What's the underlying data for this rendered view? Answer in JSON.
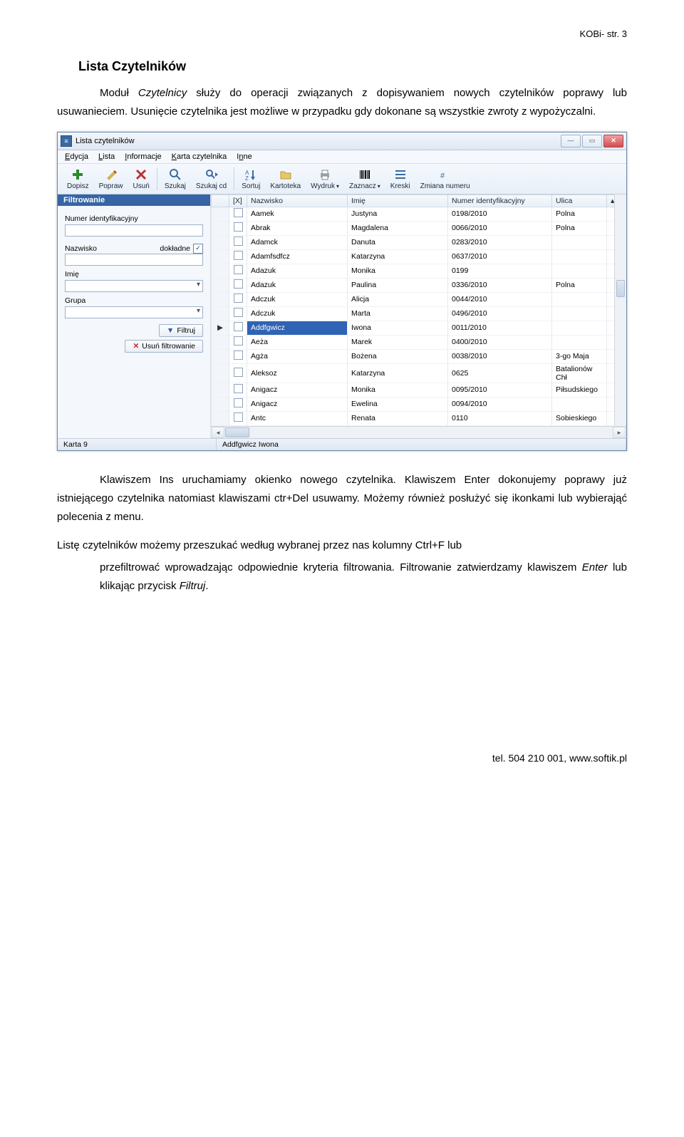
{
  "doc": {
    "header_right": "KOBi- str. 3",
    "title": "Lista Czytelników",
    "p1": "Moduł Czytelnicy służy do operacji związanych z dopisywaniem nowych czytelników poprawy lub usuwanieciem. Usunięcie czytelnika jest możliwe w przypadku gdy dokonane są wszystkie zwroty z wypożyczalni.",
    "p2": "Klawiszem Ins uruchamiamy okienko nowego czytelnika. Klawiszem Enter dokonujemy poprawy już istniejącego czytelnika natomiast klawiszami ctr+Del usuwamy. Możemy również posłużyć się ikonkami lub wybierająć polecenia z menu.",
    "p3a": "Listę czytelników możemy przeszukać według wybranej przez nas kolumny Ctrl+F lub",
    "p3b": "przefiltrować wprowadzając odpowiednie kryteria filtrowania. Filtrowanie zatwierdzamy klawiszem Enter lub klikając  przycisk Filtruj.",
    "footer": "tel. 504 210 001,  www.softik.pl"
  },
  "win": {
    "title": "Lista czytelników",
    "menus": [
      "Edycja",
      "Lista",
      "Informacje",
      "Karta czytelnika",
      "Inne"
    ],
    "toolbar": [
      "Dopisz",
      "Popraw",
      "Usuń",
      "Szukaj",
      "Szukaj cd",
      "Sortuj",
      "Kartoteka",
      "Wydruk",
      "Zaznacz",
      "Kreski",
      "Zmiana numeru"
    ],
    "sidebar": {
      "header": "Filtrowanie",
      "lbl_numer": "Numer identyfikacyjny",
      "lbl_nazwisko": "Nazwisko",
      "lbl_imie": "Imię",
      "lbl_grupa": "Grupa",
      "chk_dokladne": "dokładne",
      "btn_filtruj": "Filtruj",
      "btn_usun": "Usuń filtrowanie"
    },
    "columns": {
      "chk": "[X]",
      "nazwisko": "Nazwisko",
      "imie": "Imię",
      "numer": "Numer identyfikacyjny",
      "ulica": "Ulica"
    },
    "rows": [
      {
        "n": "Aamek",
        "i": "Justyna",
        "id": "0198/2010",
        "u": "Polna"
      },
      {
        "n": "Abrak",
        "i": "Magdalena",
        "id": "0066/2010",
        "u": "Polna"
      },
      {
        "n": "Adamck",
        "i": "Danuta",
        "id": "0283/2010",
        "u": ""
      },
      {
        "n": "Adamfsdfcz",
        "i": "Katarzyna",
        "id": "0637/2010",
        "u": ""
      },
      {
        "n": "Adazuk",
        "i": "Monika",
        "id": "0199",
        "u": ""
      },
      {
        "n": "Adazuk",
        "i": "Paulina",
        "id": "0336/2010",
        "u": "Polna"
      },
      {
        "n": "Adczuk",
        "i": "Alicja",
        "id": "0044/2010",
        "u": ""
      },
      {
        "n": "Adczuk",
        "i": "Marta",
        "id": "0496/2010",
        "u": ""
      },
      {
        "n": "Addfgwicz",
        "i": "Iwona",
        "id": "0011/2010",
        "u": "",
        "sel": true
      },
      {
        "n": "Aeża",
        "i": "Marek",
        "id": "0400/2010",
        "u": ""
      },
      {
        "n": "Agża",
        "i": "Bożena",
        "id": "0038/2010",
        "u": "3-go Maja"
      },
      {
        "n": "Aleksoz",
        "i": "Katarzyna",
        "id": "0625",
        "u": "Batalionów Chł"
      },
      {
        "n": "Anigacz",
        "i": "Monika",
        "id": "0095/2010",
        "u": "Piłsudskiego"
      },
      {
        "n": "Anigacz",
        "i": "Ewelina",
        "id": "0094/2010",
        "u": ""
      },
      {
        "n": "Antc",
        "i": "Renata",
        "id": "0110",
        "u": "Sobieskiego"
      }
    ],
    "status": {
      "left": "Karta 9",
      "mid": "Addfgwicz Iwona"
    }
  }
}
